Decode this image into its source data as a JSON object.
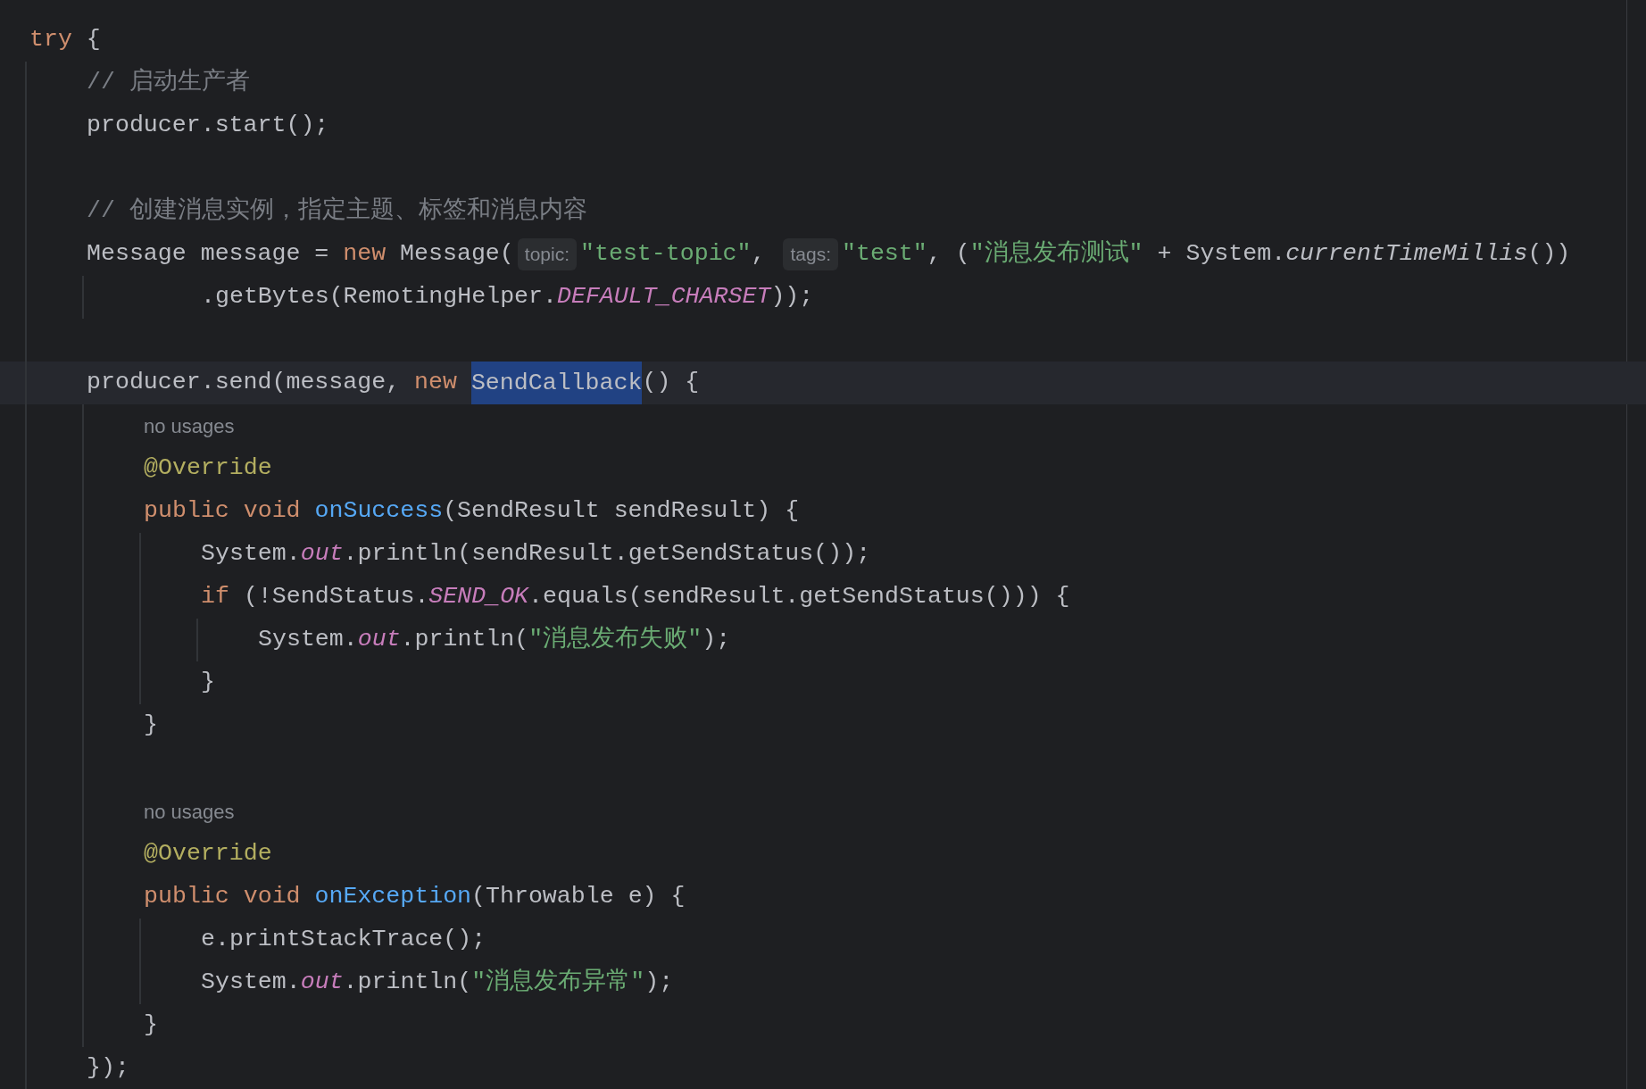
{
  "editor": {
    "lines": [
      {
        "kind": "code",
        "current": false,
        "tokens": [
          {
            "kind": "keyword",
            "text": "try"
          },
          {
            "kind": "plain",
            "text": " {"
          }
        ]
      },
      {
        "kind": "code",
        "current": false,
        "tokens": [
          {
            "kind": "comment",
            "text": "    // 启动生产者"
          }
        ]
      },
      {
        "kind": "code",
        "current": false,
        "tokens": [
          {
            "kind": "plain",
            "text": "    producer.start();"
          }
        ]
      },
      {
        "kind": "blank",
        "current": false
      },
      {
        "kind": "code",
        "current": false,
        "tokens": [
          {
            "kind": "comment",
            "text": "    // 创建消息实例，指定主题、标签和消息内容"
          }
        ]
      },
      {
        "kind": "code",
        "current": false,
        "tokens": [
          {
            "kind": "plain",
            "text": "    Message message = "
          },
          {
            "kind": "keyword",
            "text": "new"
          },
          {
            "kind": "plain",
            "text": " Message("
          },
          {
            "kind": "param_hint",
            "text": "topic:"
          },
          {
            "kind": "string",
            "text": "\"test-topic\""
          },
          {
            "kind": "plain",
            "text": ", "
          },
          {
            "kind": "param_hint",
            "text": "tags:"
          },
          {
            "kind": "string",
            "text": "\"test\""
          },
          {
            "kind": "plain",
            "text": ", ("
          },
          {
            "kind": "string",
            "text": "\"消息发布测试\""
          },
          {
            "kind": "plain",
            "text": " + System."
          },
          {
            "kind": "static_call",
            "text": "currentTimeMillis"
          },
          {
            "kind": "plain",
            "text": "())"
          }
        ]
      },
      {
        "kind": "continuation",
        "current": false,
        "tokens": [
          {
            "kind": "plain",
            "text": "            .getBytes(RemotingHelper."
          },
          {
            "kind": "static_field",
            "text": "DEFAULT_CHARSET"
          },
          {
            "kind": "plain",
            "text": "));"
          }
        ]
      },
      {
        "kind": "blank",
        "current": false
      },
      {
        "kind": "code",
        "current": true,
        "tokens": [
          {
            "kind": "plain",
            "text": "    producer.send(message, "
          },
          {
            "kind": "keyword",
            "text": "new "
          },
          {
            "kind": "selection",
            "text": "SendCallback"
          },
          {
            "kind": "plain",
            "text": "() {"
          }
        ]
      },
      {
        "kind": "code",
        "current": false,
        "tokens": [
          {
            "kind": "usage_hint",
            "text": "        no usages"
          }
        ]
      },
      {
        "kind": "code",
        "current": false,
        "tokens": [
          {
            "kind": "annotation",
            "text": "        @Override"
          }
        ]
      },
      {
        "kind": "code",
        "current": false,
        "tokens": [
          {
            "kind": "keyword",
            "text": "        public void "
          },
          {
            "kind": "method",
            "text": "onSuccess"
          },
          {
            "kind": "plain",
            "text": "(SendResult sendResult) {"
          }
        ]
      },
      {
        "kind": "code",
        "current": false,
        "tokens": [
          {
            "kind": "plain",
            "text": "            System."
          },
          {
            "kind": "static_field",
            "text": "out"
          },
          {
            "kind": "plain",
            "text": ".println(sendResult.getSendStatus());"
          }
        ]
      },
      {
        "kind": "code",
        "current": false,
        "tokens": [
          {
            "kind": "keyword",
            "text": "            if"
          },
          {
            "kind": "plain",
            "text": " (!SendStatus."
          },
          {
            "kind": "static_field",
            "text": "SEND_OK"
          },
          {
            "kind": "plain",
            "text": ".equals(sendResult.getSendStatus())) {"
          }
        ]
      },
      {
        "kind": "code",
        "current": false,
        "tokens": [
          {
            "kind": "plain",
            "text": "                System."
          },
          {
            "kind": "static_field",
            "text": "out"
          },
          {
            "kind": "plain",
            "text": ".println("
          },
          {
            "kind": "string",
            "text": "\"消息发布失败\""
          },
          {
            "kind": "plain",
            "text": ");"
          }
        ]
      },
      {
        "kind": "code",
        "current": false,
        "tokens": [
          {
            "kind": "plain",
            "text": "            }"
          }
        ]
      },
      {
        "kind": "code",
        "current": false,
        "tokens": [
          {
            "kind": "plain",
            "text": "        }"
          }
        ]
      },
      {
        "kind": "blank",
        "current": false
      },
      {
        "kind": "code",
        "current": false,
        "tokens": [
          {
            "kind": "usage_hint",
            "text": "        no usages"
          }
        ]
      },
      {
        "kind": "code",
        "current": false,
        "tokens": [
          {
            "kind": "annotation",
            "text": "        @Override"
          }
        ]
      },
      {
        "kind": "code",
        "current": false,
        "tokens": [
          {
            "kind": "keyword",
            "text": "        public void "
          },
          {
            "kind": "method",
            "text": "onException"
          },
          {
            "kind": "plain",
            "text": "(Throwable e) {"
          }
        ]
      },
      {
        "kind": "code",
        "current": false,
        "tokens": [
          {
            "kind": "plain",
            "text": "            e.printStackTrace();"
          }
        ]
      },
      {
        "kind": "code",
        "current": false,
        "tokens": [
          {
            "kind": "plain",
            "text": "            System."
          },
          {
            "kind": "static_field",
            "text": "out"
          },
          {
            "kind": "plain",
            "text": ".println("
          },
          {
            "kind": "string",
            "text": "\"消息发布异常\""
          },
          {
            "kind": "plain",
            "text": ");"
          }
        ]
      },
      {
        "kind": "code",
        "current": false,
        "tokens": [
          {
            "kind": "plain",
            "text": "        }"
          }
        ]
      },
      {
        "kind": "code",
        "current": false,
        "tokens": [
          {
            "kind": "plain",
            "text": "    });"
          }
        ]
      }
    ]
  }
}
